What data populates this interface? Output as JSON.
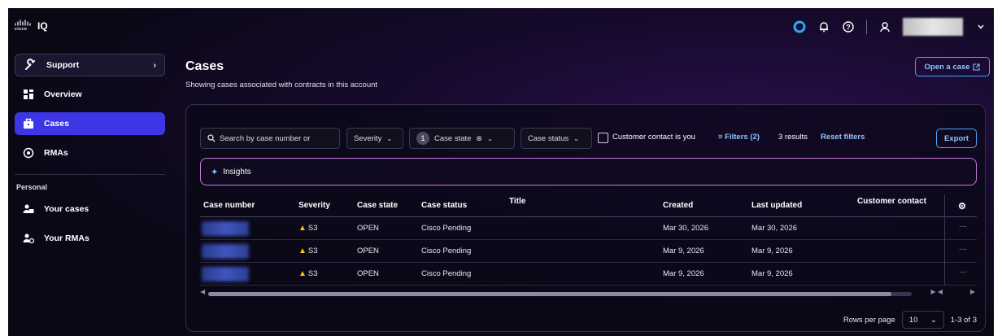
{
  "app": {
    "brand": "cisco",
    "product": "IQ"
  },
  "top_icons": [
    "copilot-icon",
    "bell-icon",
    "help-icon",
    "user-icon",
    "chevron-down-icon"
  ],
  "sidebar": {
    "support_label": "Support",
    "items": [
      {
        "label": "Overview",
        "icon": "overview-icon"
      },
      {
        "label": "Cases",
        "icon": "cases-icon",
        "active": true
      },
      {
        "label": "RMAs",
        "icon": "rma-icon"
      }
    ],
    "personal_section": "Personal",
    "personal_items": [
      {
        "label": "Your cases",
        "icon": "your-cases-icon"
      },
      {
        "label": "Your RMAs",
        "icon": "your-rmas-icon"
      }
    ]
  },
  "page": {
    "title": "Cases",
    "subtitle": "Showing cases associated with contracts in this account",
    "open_case_label": "Open a case"
  },
  "filters": {
    "search_placeholder": "Search by case number or",
    "severity_label": "Severity",
    "case_state_count": "1",
    "case_state_label": "Case state",
    "case_status_label": "Case status",
    "customer_contact_label": "Customer contact is you",
    "filters_link": "Filters (2)",
    "results": "3 results",
    "reset": "Reset filters",
    "export_label": "Export"
  },
  "insights_label": "Insights",
  "table": {
    "columns": [
      "Case number",
      "Severity",
      "Case state",
      "Case status",
      "Title",
      "Created",
      "Last updated",
      "Customer contact"
    ],
    "rows": [
      {
        "severity": "S3",
        "state": "OPEN",
        "status": "Cisco Pending",
        "title": "",
        "created": "Mar 30, 2026",
        "updated": "Mar 30, 2026",
        "contact": ""
      },
      {
        "severity": "S3",
        "state": "OPEN",
        "status": "Cisco Pending",
        "title": "",
        "created": "Mar 9, 2026",
        "updated": "Mar 9, 2026",
        "contact": ""
      },
      {
        "severity": "S3",
        "state": "OPEN",
        "status": "Cisco Pending",
        "title": "",
        "created": "Mar 9, 2026",
        "updated": "Mar 9, 2026",
        "contact": ""
      }
    ]
  },
  "pagination": {
    "rows_per_page_label": "Rows per page",
    "rows_per_page": "10",
    "range": "1-3 of 3"
  },
  "colors": {
    "accent": "#3d36e6",
    "link": "#8ec5ff",
    "warning": "#f5c518",
    "insights_border": "#c27ad8"
  }
}
